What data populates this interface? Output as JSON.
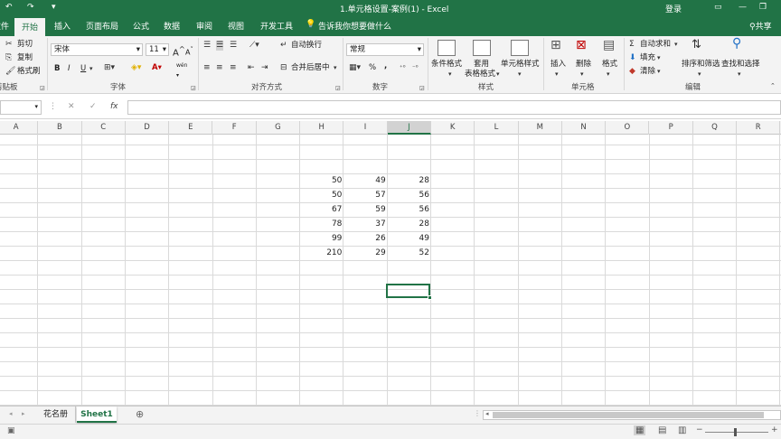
{
  "title_bar": {
    "quick_access": [
      "↶",
      "↷",
      "▾"
    ],
    "document_title": "1.单元格设置-案例(1)  -  Excel",
    "login": "登录",
    "win_controls": [
      "▭",
      "—",
      "❐"
    ]
  },
  "tabs": [
    "文件",
    "开始",
    "插入",
    "页面布局",
    "公式",
    "数据",
    "审阅",
    "视图",
    "开发工具"
  ],
  "tell_me": "告诉我你想要做什么",
  "share": "共享",
  "ribbon": {
    "clipboard": {
      "cut": "剪切",
      "copy": "复制",
      "format_painter": "格式刷",
      "group": "剪贴板"
    },
    "font": {
      "name": "宋体",
      "size": "11",
      "grow": "A",
      "shrink": "A",
      "bold": "B",
      "italic": "I",
      "underline": "U",
      "group": "字体",
      "color_a": "A",
      "wen": "wén"
    },
    "alignment": {
      "wrap": "自动换行",
      "merge": "合并后居中",
      "group": "对齐方式"
    },
    "number": {
      "format": "常规",
      "percent": "%",
      "comma": ",",
      "group": "数字"
    },
    "styles": {
      "conditional": "条件格式",
      "table_l1": "套用",
      "table_l2": "表格格式",
      "cell_styles": "单元格样式",
      "group": "样式"
    },
    "cells": {
      "insert": "插入",
      "delete": "删除",
      "format": "格式",
      "group": "单元格"
    },
    "editing": {
      "autosum": "自动求和",
      "fill": "填充",
      "clear": "清除",
      "sort": "排序和筛选",
      "find": "查找和选择",
      "group": "编辑"
    }
  },
  "formula_bar": {
    "fx": "fx",
    "cancel": "✕",
    "enter": "✓",
    "dots": "⋮"
  },
  "columns": [
    "A",
    "B",
    "C",
    "D",
    "E",
    "F",
    "G",
    "H",
    "I",
    "J",
    "K",
    "L",
    "M",
    "N",
    "O",
    "P",
    "Q",
    "R"
  ],
  "selected_column": "J",
  "table": [
    [
      "50",
      "49",
      "28"
    ],
    [
      "50",
      "57",
      "56"
    ],
    [
      "67",
      "59",
      "56"
    ],
    [
      "78",
      "37",
      "28"
    ],
    [
      "99",
      "26",
      "49"
    ],
    [
      "210",
      "29",
      "52"
    ]
  ],
  "sheets": [
    {
      "name": "花名册",
      "active": false
    },
    {
      "name": "Sheet1",
      "active": true
    }
  ],
  "add_sheet": "⊕",
  "colors": {
    "brand": "#217346",
    "ribbon_bg": "#f3f3f3",
    "grid": "#dadada"
  }
}
